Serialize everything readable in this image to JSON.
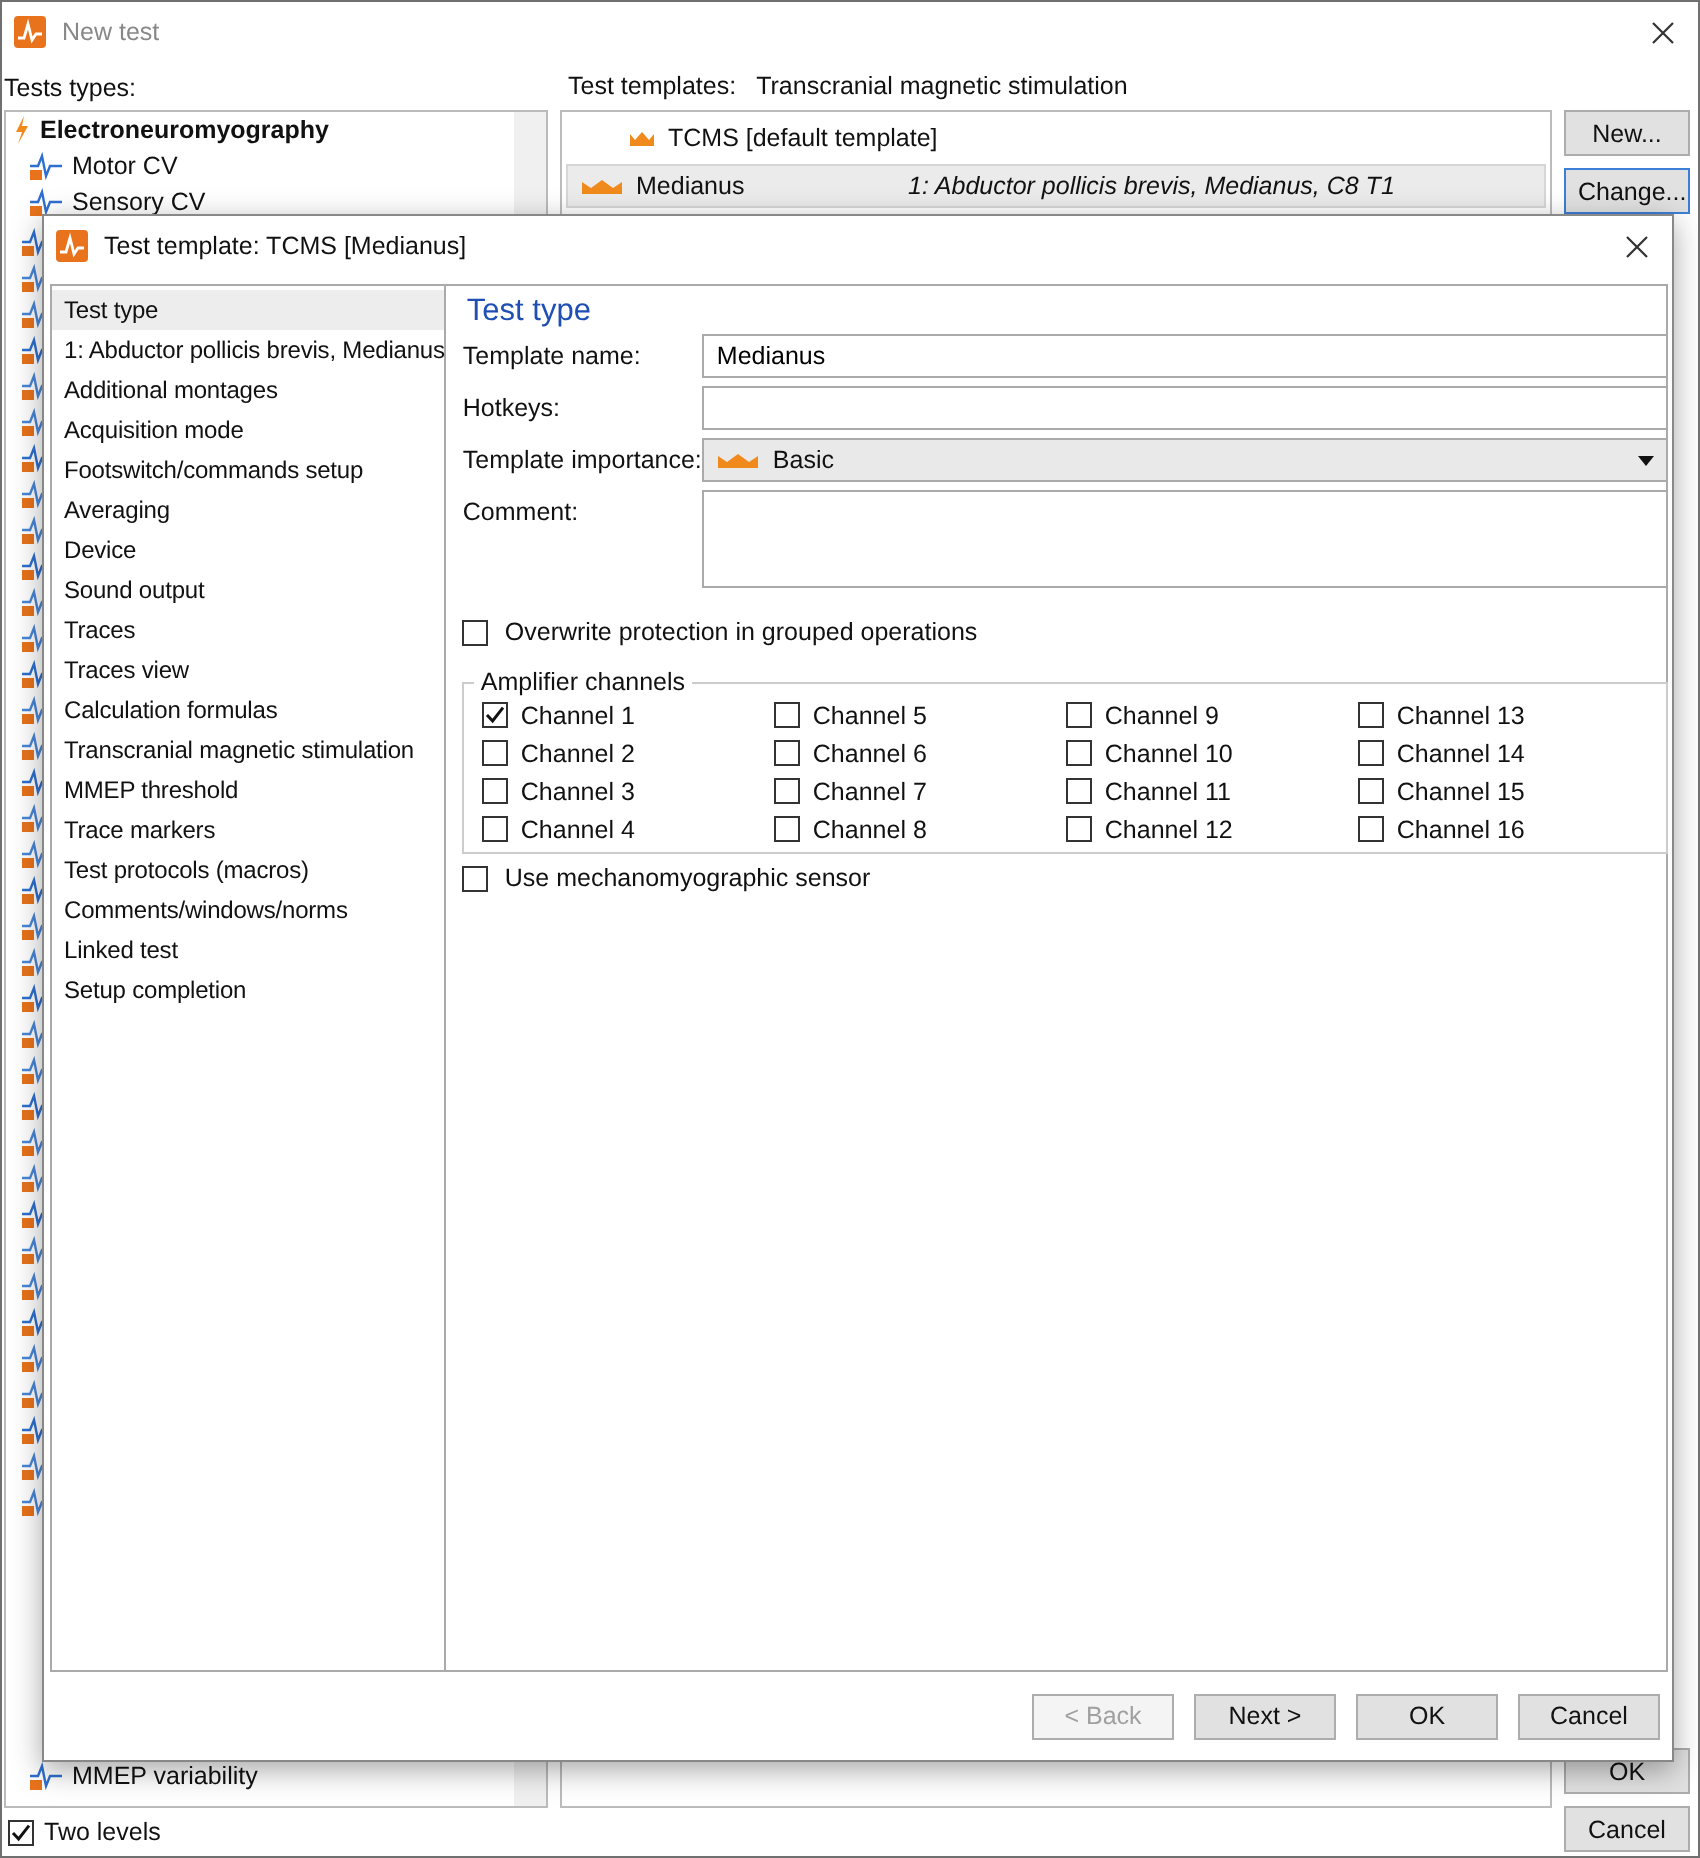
{
  "window": {
    "title": "New test"
  },
  "tests_types": {
    "label": "Tests types:",
    "items": [
      {
        "label": "Electroneuromyography",
        "kind": "group"
      },
      {
        "label": "Motor CV",
        "kind": "test"
      },
      {
        "label": "Sensory CV",
        "kind": "test"
      }
    ],
    "items_below": [
      {
        "label": "MMEP variability"
      }
    ],
    "two_levels": {
      "label": "Two levels",
      "checked": true
    }
  },
  "test_templates": {
    "label": "Test templates:",
    "value": "Transcranial magnetic stimulation",
    "rows": [
      {
        "name": "TCMS [default template]",
        "detail": "",
        "selected": false
      },
      {
        "name": "Medianus",
        "detail": "1: Abductor pollicis brevis, Medianus, C8 T1",
        "selected": true
      }
    ]
  },
  "side_buttons": [
    "New...",
    "Change..."
  ],
  "bottom_buttons": [
    "OK",
    "Cancel"
  ],
  "dialog": {
    "title": "Test template: TCMS [Medianus]",
    "nav": [
      {
        "label": "Test type",
        "selected": true
      },
      {
        "label": "1: Abductor pollicis brevis, Medianus",
        "selected": false
      },
      {
        "label": "Additional montages",
        "selected": false
      },
      {
        "label": "Acquisition mode",
        "selected": false
      },
      {
        "label": "Footswitch/commands setup",
        "selected": false
      },
      {
        "label": "Averaging",
        "selected": false
      },
      {
        "label": "Device",
        "selected": false
      },
      {
        "label": "Sound output",
        "selected": false
      },
      {
        "label": "Traces",
        "selected": false
      },
      {
        "label": "Traces view",
        "selected": false
      },
      {
        "label": "Calculation formulas",
        "selected": false
      },
      {
        "label": "Transcranial magnetic stimulation",
        "selected": false
      },
      {
        "label": "MMEP threshold",
        "selected": false
      },
      {
        "label": "Trace markers",
        "selected": false
      },
      {
        "label": "Test protocols (macros)",
        "selected": false
      },
      {
        "label": "Comments/windows/norms",
        "selected": false
      },
      {
        "label": "Linked test",
        "selected": false
      },
      {
        "label": "Setup completion",
        "selected": false
      }
    ],
    "heading": "Test type",
    "template_name": {
      "label": "Template name:",
      "value": "Medianus"
    },
    "hotkeys": {
      "label": "Hotkeys:"
    },
    "importance": {
      "label": "Template importance:",
      "value": "Basic"
    },
    "comment": {
      "label": "Comment:"
    },
    "overwrite": {
      "label": "Overwrite protection in grouped operations",
      "checked": false
    },
    "amplifier": {
      "title": "Amplifier channels",
      "channels": [
        {
          "label": "Channel 1",
          "checked": true
        },
        {
          "label": "Channel 2",
          "checked": false
        },
        {
          "label": "Channel 3",
          "checked": false
        },
        {
          "label": "Channel 4",
          "checked": false
        },
        {
          "label": "Channel 5",
          "checked": false
        },
        {
          "label": "Channel 6",
          "checked": false
        },
        {
          "label": "Channel 7",
          "checked": false
        },
        {
          "label": "Channel 8",
          "checked": false
        },
        {
          "label": "Channel 9",
          "checked": false
        },
        {
          "label": "Channel 10",
          "checked": false
        },
        {
          "label": "Channel 11",
          "checked": false
        },
        {
          "label": "Channel 12",
          "checked": false
        },
        {
          "label": "Channel 13",
          "checked": false
        },
        {
          "label": "Channel 14",
          "checked": false
        },
        {
          "label": "Channel 15",
          "checked": false
        },
        {
          "label": "Channel 16",
          "checked": false
        }
      ]
    },
    "mechanomyographic": {
      "label": "Use mechanomyographic sensor",
      "checked": false
    },
    "buttons": [
      {
        "label": "< Back",
        "disabled": true
      },
      {
        "label": "Next >",
        "disabled": false
      },
      {
        "label": "OK",
        "disabled": false
      },
      {
        "label": "Cancel",
        "disabled": false
      }
    ]
  }
}
